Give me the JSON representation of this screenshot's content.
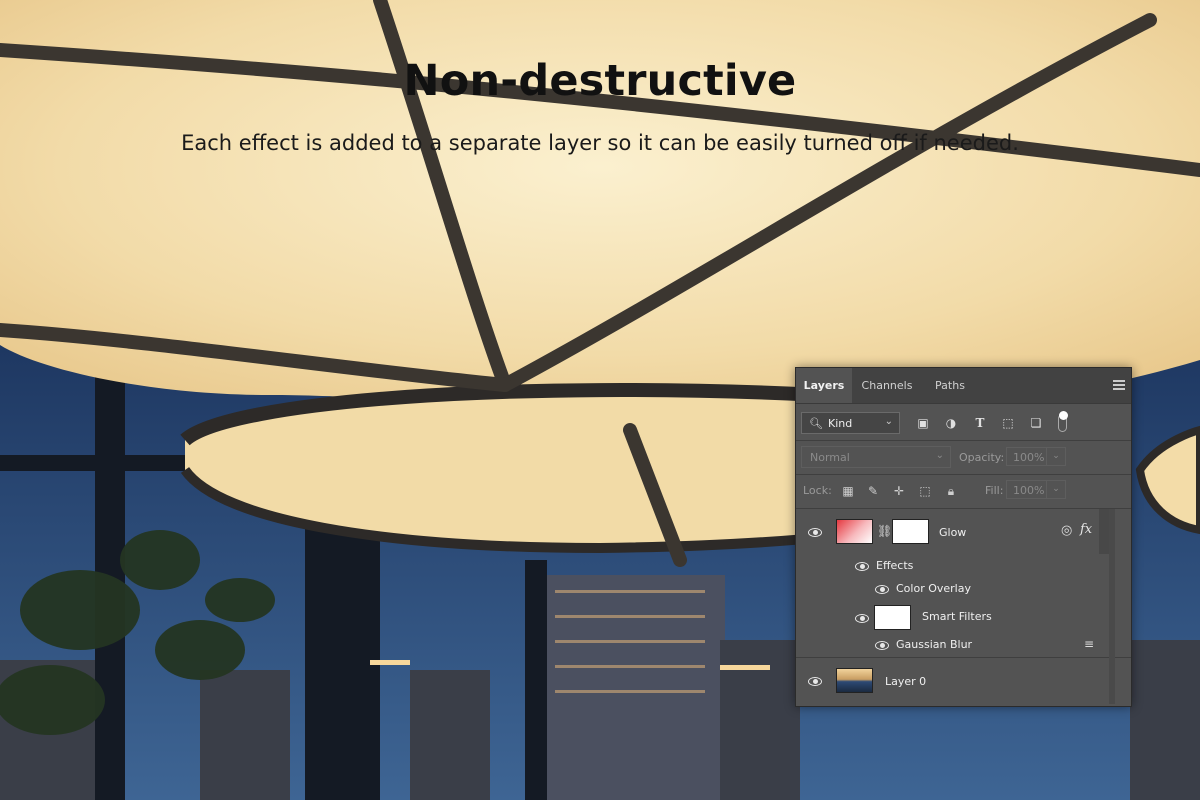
{
  "headline": "Non-destructive",
  "subheadline": "Each effect is added to a separate layer so it can be easily turned off if needed.",
  "panel": {
    "tabs": [
      "Layers",
      "Channels",
      "Paths"
    ],
    "active_tab": "Layers",
    "filter_kind": "Kind",
    "blend_mode": "Normal",
    "opacity_label": "Opacity:",
    "opacity_value": "100%",
    "lock_label": "Lock:",
    "fill_label": "Fill:",
    "fill_value": "100%",
    "layers": {
      "glow": "Glow",
      "effects": "Effects",
      "color_overlay": "Color Overlay",
      "smart_filters": "Smart Filters",
      "gaussian_blur": "Gaussian Blur",
      "layer0": "Layer 0"
    },
    "fx_label": "fx"
  },
  "colors": {
    "panel_bg": "#535353",
    "tab_bar_bg": "#424242",
    "glow_light": "#f5e3b4"
  }
}
